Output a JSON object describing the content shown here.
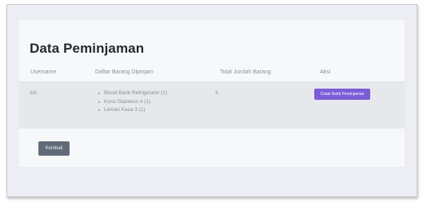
{
  "page": {
    "title": "Data Peminjaman"
  },
  "table": {
    "headers": [
      "Username",
      "Daftar Barang Dipinjam",
      "Total Jumlah Barang",
      "Aksi"
    ],
    "rows": [
      {
        "username": "dol",
        "items": [
          "Blood Bank Refrigerator (1)",
          "Kursi Stainless 4 (1)",
          "Lemari Kaca 3 (1)"
        ],
        "total": "3",
        "action_label": "Cetak Bukti Peminjaman"
      }
    ]
  },
  "buttons": {
    "back_label": "Kembali"
  },
  "colors": {
    "accent": "#7b5cd6",
    "secondary": "#616b78"
  }
}
